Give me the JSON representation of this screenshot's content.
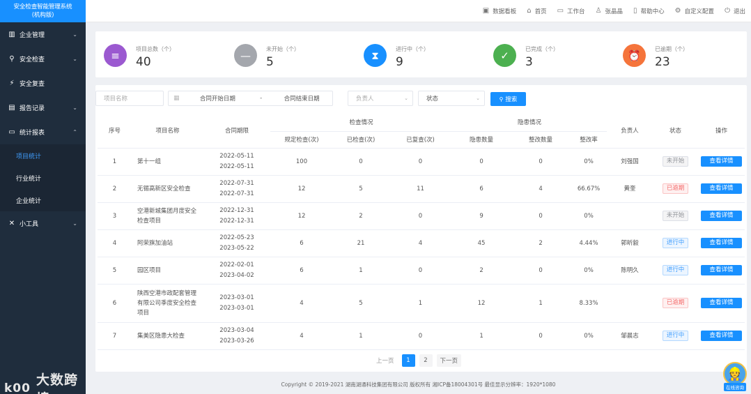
{
  "brand": {
    "line1": "安全检查智能管理系统",
    "line2": "(机构版)"
  },
  "sidebar": {
    "items": [
      {
        "label": "企业管理",
        "icon": "building-icon",
        "glyph": "▥",
        "chevron": "⌄"
      },
      {
        "label": "安全检查",
        "icon": "inspect-icon",
        "glyph": "⚲",
        "chevron": "⌄"
      },
      {
        "label": "安全复查",
        "icon": "lightning-icon",
        "glyph": "⚡",
        "chevron": ""
      },
      {
        "label": "报告记录",
        "icon": "report-icon",
        "glyph": "▤",
        "chevron": "⌄"
      },
      {
        "label": "统计报表",
        "icon": "folder-icon",
        "glyph": "▭",
        "chevron": "⌃"
      }
    ],
    "sub_items": [
      {
        "label": "项目统计",
        "active": true
      },
      {
        "label": "行业统计",
        "active": false
      },
      {
        "label": "企业统计",
        "active": false
      }
    ],
    "tools": {
      "label": "小工具",
      "glyph": "✕",
      "chevron": "⌄"
    }
  },
  "topbar": {
    "links": [
      {
        "label": "数据看板",
        "icon": "dashboard-icon",
        "glyph": "▣"
      },
      {
        "label": "首页",
        "icon": "home-icon",
        "glyph": "⌂"
      },
      {
        "label": "工作台",
        "icon": "monitor-icon",
        "glyph": "▭"
      },
      {
        "label": "张晶晶",
        "icon": "user-icon",
        "glyph": "♙"
      },
      {
        "label": "帮助中心",
        "icon": "book-icon",
        "glyph": "▯"
      },
      {
        "label": "自定义配置",
        "icon": "gear-icon",
        "glyph": "⚙"
      },
      {
        "label": "退出",
        "icon": "power-icon",
        "glyph": "⏻"
      }
    ]
  },
  "stats": [
    {
      "label": "项目总数（个）",
      "value": "40",
      "color": "#9b59d0",
      "icon": "database-icon",
      "glyph": "≡"
    },
    {
      "label": "未开始（个）",
      "value": "5",
      "color": "#a4a7ad",
      "icon": "minus-icon",
      "glyph": "—"
    },
    {
      "label": "进行中（个）",
      "value": "9",
      "color": "#1890ff",
      "icon": "hourglass-icon",
      "glyph": "⧗"
    },
    {
      "label": "已完成（个）",
      "value": "3",
      "color": "#4cb050",
      "icon": "check-icon",
      "glyph": "✓"
    },
    {
      "label": "已逾期（个）",
      "value": "23",
      "color": "#f5743b",
      "icon": "alarm-clock-icon",
      "glyph": "⏰"
    }
  ],
  "filters": {
    "project_name_placeholder": "项目名称",
    "date_start_placeholder": "合同开始日期",
    "date_separator": "-",
    "date_end_placeholder": "合同结束日期",
    "owner_placeholder": "负责人",
    "status_placeholder": "状态",
    "search_label": "搜索"
  },
  "table": {
    "headers": {
      "index": "序号",
      "name": "项目名称",
      "period": "合同期限",
      "check_group": "检查情况",
      "hazard_group": "隐患情况",
      "planned": "规定检查(次)",
      "checked": "已检查(次)",
      "rechecked": "已复查(次)",
      "hazards": "隐患数量",
      "fixed": "整改数量",
      "rate": "整改率",
      "owner": "负责人",
      "status": "状态",
      "action": "操作"
    },
    "action_label": "查看详情",
    "rows": [
      {
        "index": "1",
        "name": "第十一组",
        "start": "2022-05-11",
        "end": "2022-05-11",
        "planned": "100",
        "checked": "0",
        "rechecked": "0",
        "hazards": "0",
        "fixed": "0",
        "rate": "0%",
        "owner": "刘强国",
        "status": "未开始",
        "status_type": "notstart"
      },
      {
        "index": "2",
        "name": "无锡高新区安全检查",
        "start": "2022-07-31",
        "end": "2022-07-31",
        "planned": "12",
        "checked": "5",
        "rechecked": "11",
        "hazards": "6",
        "fixed": "4",
        "rate": "66.67%",
        "owner": "黄奎",
        "status": "已逾期",
        "status_type": "overdue"
      },
      {
        "index": "3",
        "name": "空港新城集团月度安全检查项目",
        "start": "2022-12-31",
        "end": "2022-12-31",
        "planned": "12",
        "checked": "2",
        "rechecked": "0",
        "hazards": "9",
        "fixed": "0",
        "rate": "0%",
        "owner": "",
        "status": "未开始",
        "status_type": "notstart"
      },
      {
        "index": "4",
        "name": "阿荣旗加油站",
        "start": "2022-05-23",
        "end": "2023-05-22",
        "planned": "6",
        "checked": "21",
        "rechecked": "4",
        "hazards": "45",
        "fixed": "2",
        "rate": "4.44%",
        "owner": "郭昕毅",
        "status": "进行中",
        "status_type": "progress"
      },
      {
        "index": "5",
        "name": "园区项目",
        "start": "2022-02-01",
        "end": "2023-04-02",
        "planned": "6",
        "checked": "1",
        "rechecked": "0",
        "hazards": "2",
        "fixed": "0",
        "rate": "0%",
        "owner": "陈明久",
        "status": "进行中",
        "status_type": "progress"
      },
      {
        "index": "6",
        "name": "陕西空港市政配套管理有限公司季度安全检查项目",
        "start": "2023-03-01",
        "end": "2023-03-01",
        "planned": "4",
        "checked": "5",
        "rechecked": "1",
        "hazards": "12",
        "fixed": "1",
        "rate": "8.33%",
        "owner": "",
        "status": "已逾期",
        "status_type": "overdue"
      },
      {
        "index": "7",
        "name": "集美区隐患大检查",
        "start": "2023-03-04",
        "end": "2023-03-26",
        "planned": "4",
        "checked": "1",
        "rechecked": "0",
        "hazards": "1",
        "fixed": "0",
        "rate": "0%",
        "owner": "邹晨志",
        "status": "进行中",
        "status_type": "progress"
      }
    ]
  },
  "pagination": {
    "prev": "上一页",
    "pages": [
      "1",
      "2"
    ],
    "current": "1",
    "next": "下一页"
  },
  "footer": {
    "text": "Copyright © 2019-2021 湖南湖通科技集团有限公司 版权所有 湘ICP备18004301号 最佳显示分辨率：1920*1080"
  },
  "helper": {
    "label": "在线咨询"
  },
  "watermark": {
    "logo": "k00",
    "text": "大数跨境"
  }
}
